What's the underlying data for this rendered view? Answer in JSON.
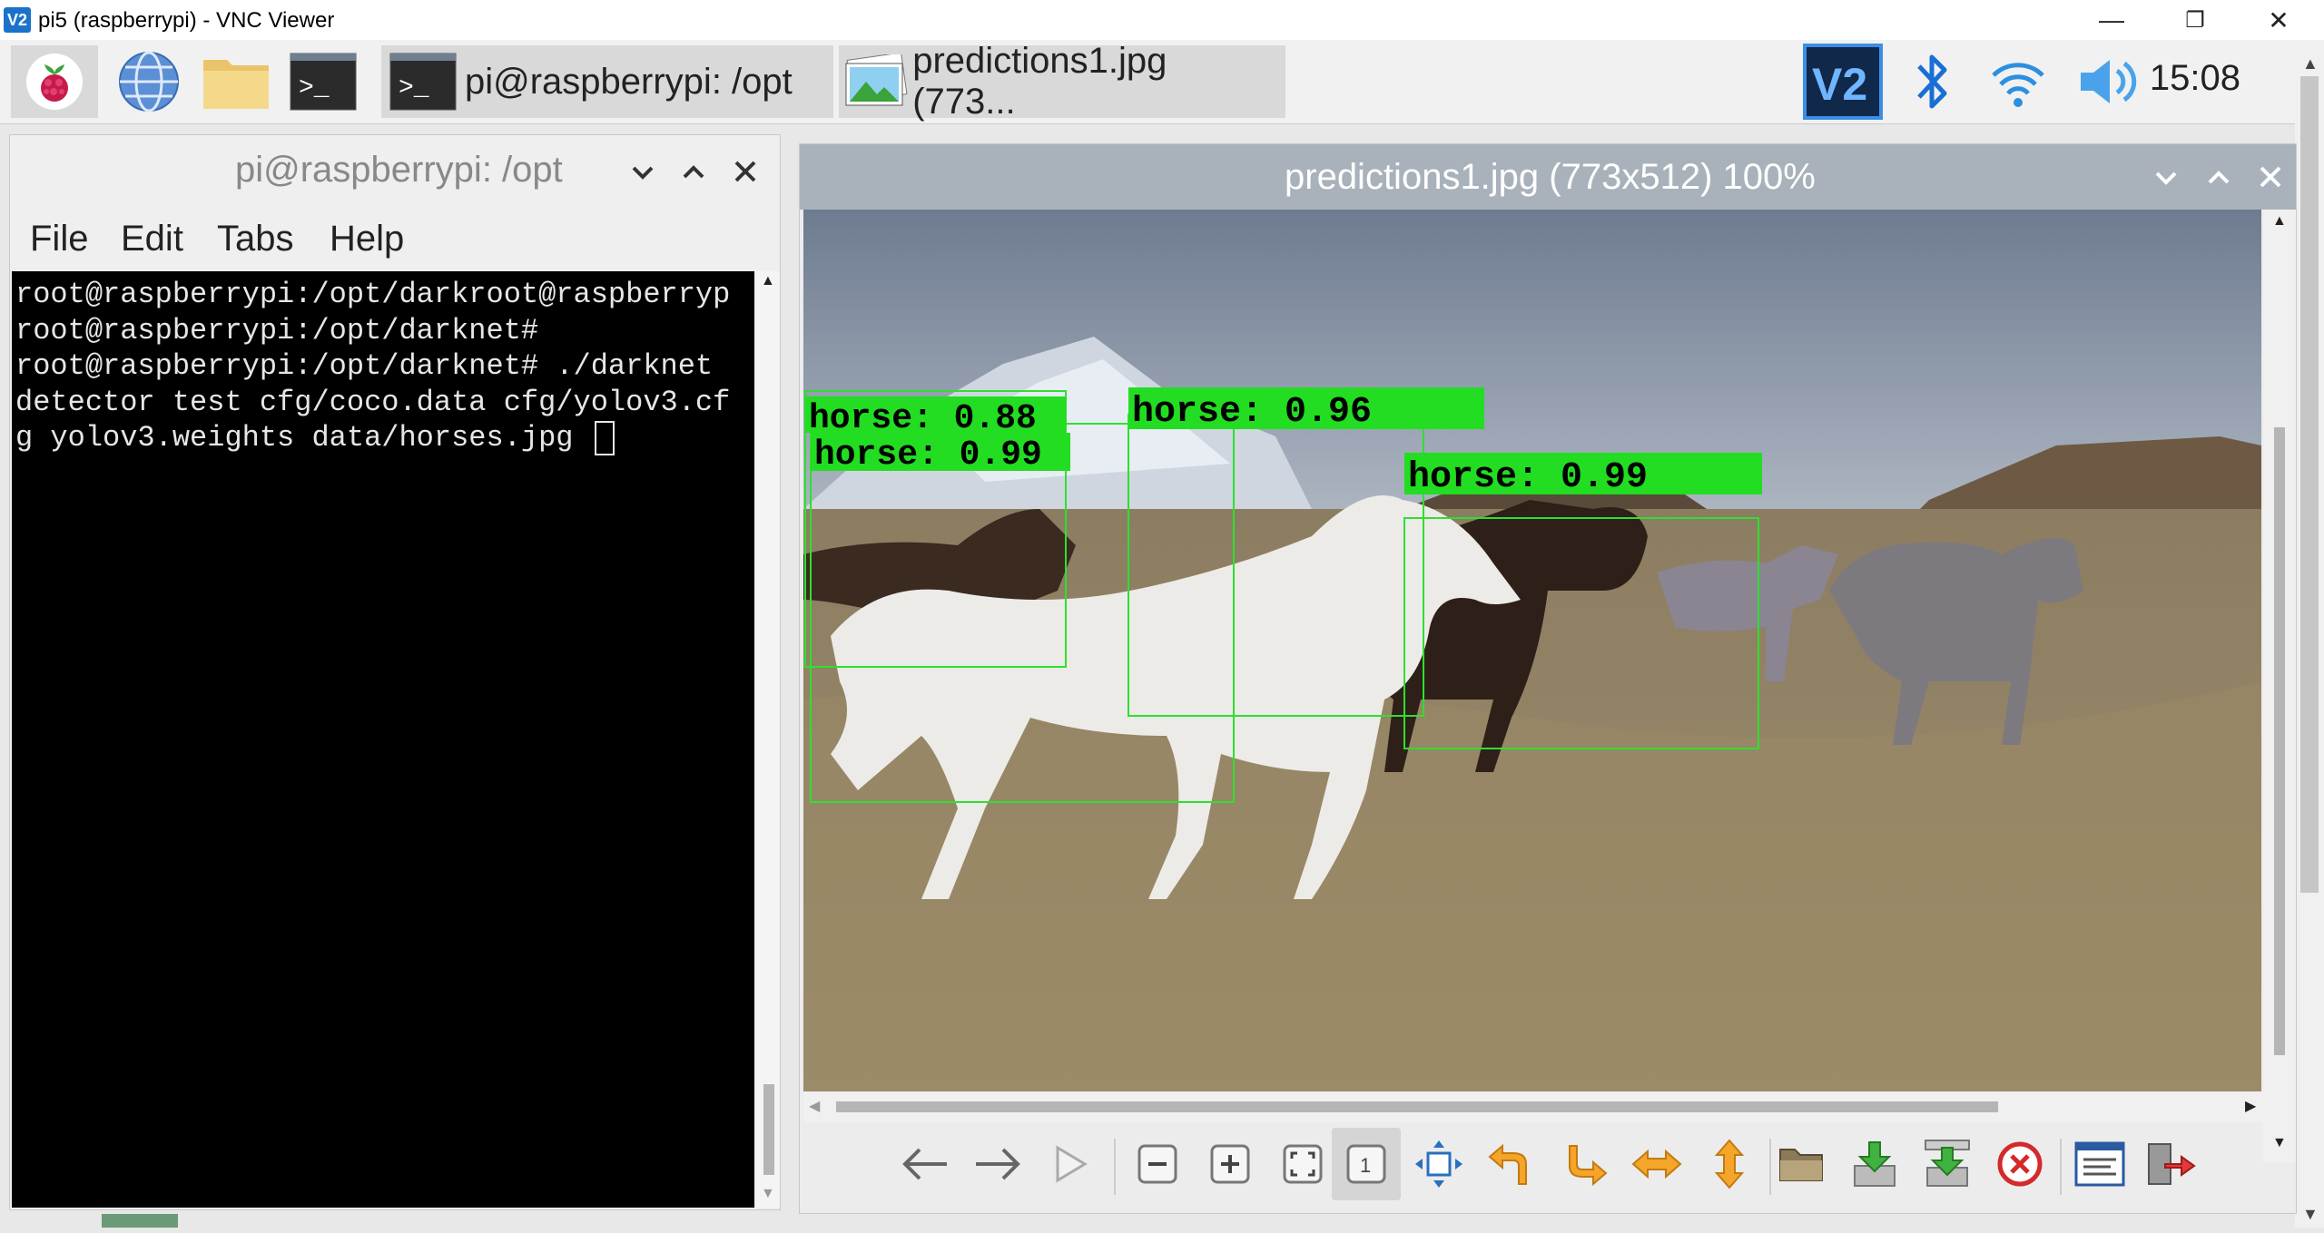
{
  "vnc": {
    "logo": "V2",
    "title": "pi5 (raspberrypi) - VNC Viewer",
    "minimize": "—",
    "restore": "❐",
    "close": "✕"
  },
  "taskbar": {
    "icons": [
      "raspberry-icon",
      "globe-icon",
      "folder-icon",
      "terminal-icon"
    ],
    "tasks": [
      {
        "label": "pi@raspberrypi: /opt",
        "icon": "terminal-icon"
      },
      {
        "label": "predictions1.jpg (773...",
        "icon": "image-icon"
      }
    ],
    "tray": [
      "vnc-icon",
      "bluetooth-icon",
      "wifi-icon",
      "volume-icon"
    ],
    "clock": "15:08"
  },
  "terminal": {
    "title": "pi@raspberrypi: /opt",
    "menu": [
      "File",
      "Edit",
      "Tabs",
      "Help"
    ],
    "lines": [
      "root@raspberrypi:/opt/darkroot@raspberryp",
      "root@raspberrypi:/opt/darknet#",
      "root@raspberrypi:/opt/darknet# ./darknet",
      "detector test cfg/coco.data cfg/yolov3.cf",
      "g yolov3.weights data/horses.jpg "
    ]
  },
  "viewer": {
    "title": "predictions1.jpg (773x512) 100%",
    "detections": [
      {
        "label": "horse",
        "score": "0.88",
        "text": "horse: 0.88"
      },
      {
        "label": "horse",
        "score": "0.99",
        "text": "horse: 0.99"
      },
      {
        "label": "horse",
        "score": "0.96",
        "text": "horse: 0.96"
      },
      {
        "label": "horse",
        "score": "0.99",
        "text": "horse: 0.99"
      }
    ],
    "toolbar": [
      "prev-icon",
      "next-icon",
      "slideshow-icon",
      "zoom-out-icon",
      "zoom-in-icon",
      "zoom-fit-icon",
      "zoom-original-icon",
      "fullscreen-icon",
      "rotate-left-icon",
      "rotate-right-icon",
      "flip-horizontal-icon",
      "flip-vertical-icon",
      "open-file-icon",
      "save-icon",
      "save-as-icon",
      "delete-icon",
      "preferences-icon",
      "quit-icon"
    ]
  },
  "colors": {
    "taskbar_active": "#d9d9d9",
    "viewer_title": "#a9b2bb",
    "detection_box": "#2ee02e",
    "label_bg": "#22dd22"
  }
}
